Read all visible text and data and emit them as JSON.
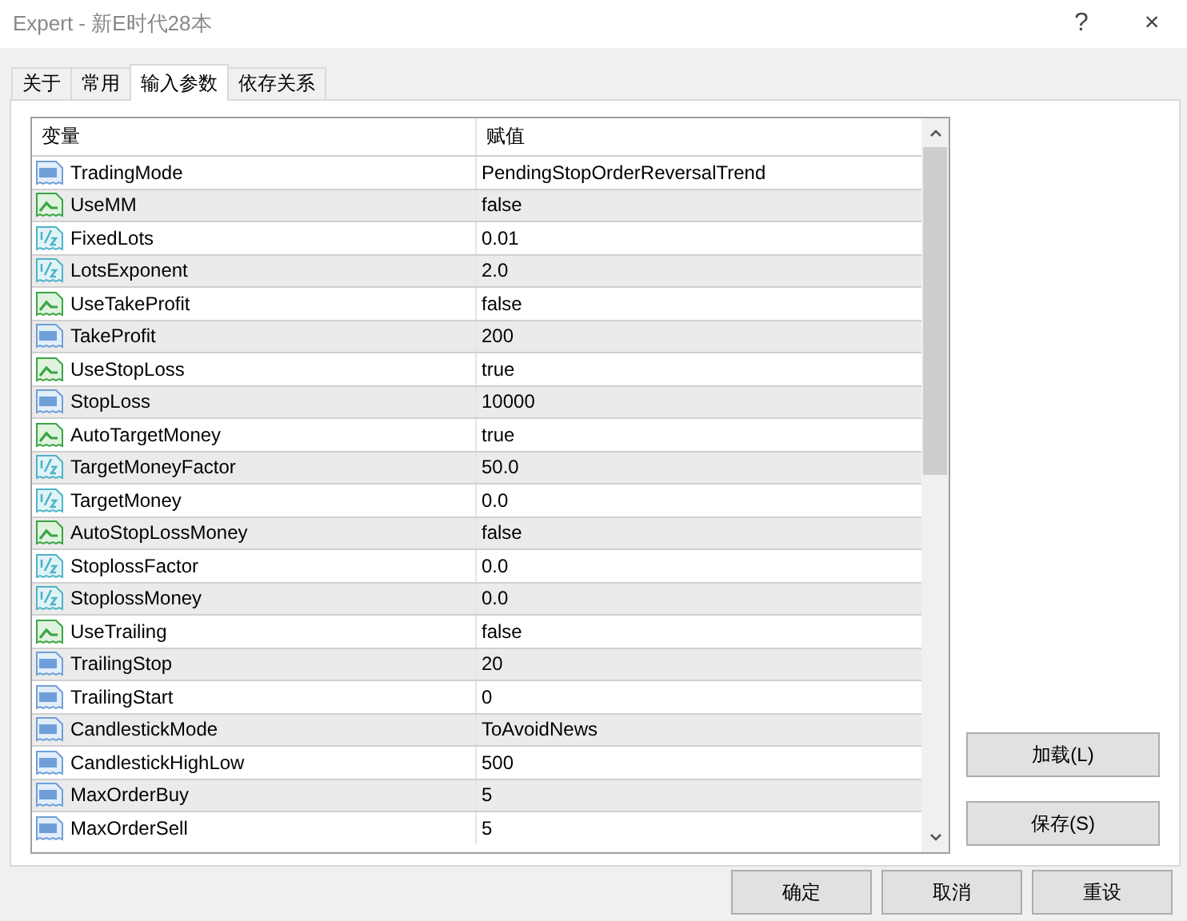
{
  "window": {
    "title": "Expert - 新E时代28本",
    "help": "?",
    "close": "×"
  },
  "tabs": [
    {
      "label": "关于",
      "selected": false
    },
    {
      "label": "常用",
      "selected": false
    },
    {
      "label": "输入参数",
      "selected": true
    },
    {
      "label": "依存关系",
      "selected": false
    }
  ],
  "table": {
    "columns": [
      "变量",
      "赋值"
    ],
    "rows": [
      {
        "kind": "int",
        "name": "TradingMode",
        "value": "PendingStopOrderReversalTrend"
      },
      {
        "kind": "bool",
        "name": "UseMM",
        "value": "false"
      },
      {
        "kind": "double",
        "name": "FixedLots",
        "value": "0.01"
      },
      {
        "kind": "double",
        "name": "LotsExponent",
        "value": "2.0"
      },
      {
        "kind": "bool",
        "name": "UseTakeProfit",
        "value": "false"
      },
      {
        "kind": "int",
        "name": "TakeProfit",
        "value": "200"
      },
      {
        "kind": "bool",
        "name": "UseStopLoss",
        "value": "true"
      },
      {
        "kind": "int",
        "name": "StopLoss",
        "value": "10000"
      },
      {
        "kind": "bool",
        "name": "AutoTargetMoney",
        "value": "true"
      },
      {
        "kind": "double",
        "name": "TargetMoneyFactor",
        "value": "50.0"
      },
      {
        "kind": "double",
        "name": "TargetMoney",
        "value": "0.0"
      },
      {
        "kind": "bool",
        "name": "AutoStopLossMoney",
        "value": "false"
      },
      {
        "kind": "double",
        "name": "StoplossFactor",
        "value": "0.0"
      },
      {
        "kind": "double",
        "name": "StoplossMoney",
        "value": "0.0"
      },
      {
        "kind": "bool",
        "name": "UseTrailing",
        "value": "false"
      },
      {
        "kind": "int",
        "name": "TrailingStop",
        "value": "20"
      },
      {
        "kind": "int",
        "name": "TrailingStart",
        "value": "0"
      },
      {
        "kind": "int",
        "name": "CandlestickMode",
        "value": "ToAvoidNews"
      },
      {
        "kind": "int",
        "name": "CandlestickHighLow",
        "value": "500"
      },
      {
        "kind": "int",
        "name": "MaxOrderBuy",
        "value": "5"
      },
      {
        "kind": "int",
        "name": "MaxOrderSell",
        "value": "5"
      }
    ]
  },
  "side_buttons": [
    "加载(L)",
    "保存(S)"
  ],
  "buttons": [
    "确定",
    "取消",
    "重设"
  ]
}
